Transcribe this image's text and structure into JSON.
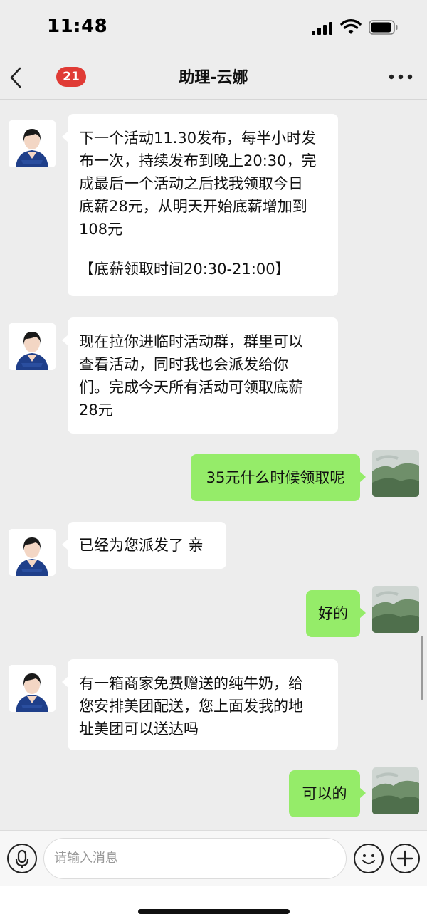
{
  "status_bar": {
    "time": "11:48"
  },
  "nav": {
    "badge_count": "21",
    "title": "助理-云娜",
    "back_icon": "chevron-left-icon",
    "more_icon": "more-dots-icon"
  },
  "messages": [
    {
      "from": "assistant",
      "lines": [
        "下一个活动11.30发布，每半小时发",
        "布一次，持续发布到晚上20:30，完",
        "成最后一个活动之后找我领取今日",
        "底薪28元，从明天开始底薪增加到",
        "108元"
      ],
      "extra": "【底薪领取时间20:30-21:00】"
    },
    {
      "from": "assistant",
      "lines": [
        "现在拉你进临时活动群，群里可以",
        "查看活动，同时我也会派发给你",
        "们。完成今天所有活动可领取底薪",
        "28元"
      ]
    },
    {
      "from": "me",
      "text": "35元什么时候领取呢"
    },
    {
      "from": "assistant",
      "text": "已经为您派发了 亲"
    },
    {
      "from": "me",
      "text": "好的"
    },
    {
      "from": "assistant",
      "lines": [
        "有一箱商家免费赠送的纯牛奶，给",
        "您安排美团配送，您上面发我的地",
        "址美团可以送达吗"
      ]
    },
    {
      "from": "me",
      "text": "可以的"
    }
  ],
  "input": {
    "placeholder": "请输入消息",
    "voice_icon": "microphone-icon",
    "emoji_icon": "emoji-icon",
    "more_icon": "plus-icon"
  },
  "colors": {
    "outgoing_bubble": "#95ec69",
    "badge": "#e03b35",
    "background": "#ededed"
  }
}
